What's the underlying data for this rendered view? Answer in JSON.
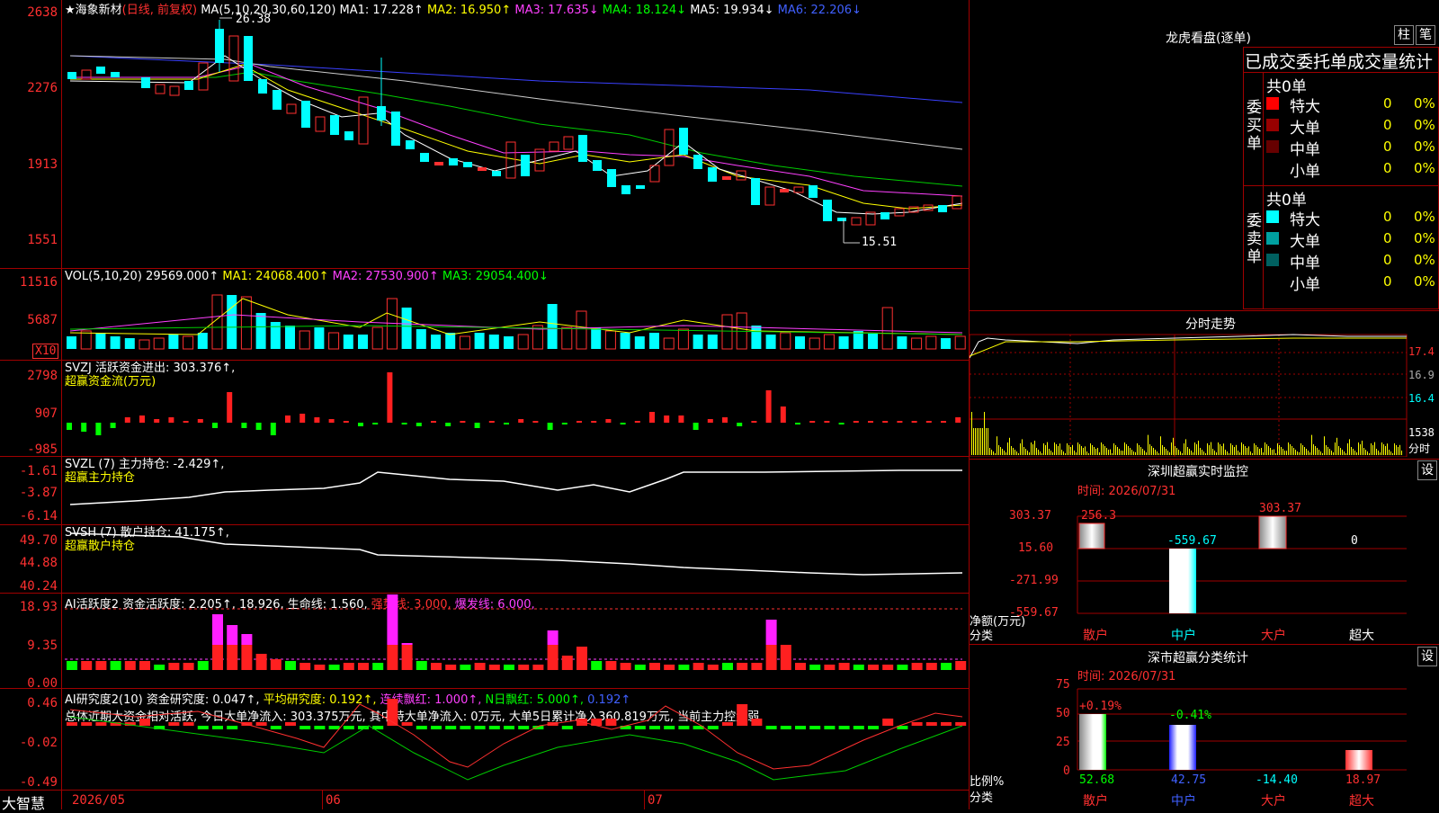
{
  "main": {
    "title": "★海象新材",
    "period": "(日线, 前复权)",
    "ma_label": "MA(5,10,20,30,60,120)",
    "ma1": "MA1: 17.228↑",
    "ma2": "MA2: 16.950↑",
    "ma3": "MA3: 17.635↓",
    "ma4": "MA4: 18.124↓",
    "ma5": "MA5: 19.934↓",
    "ma6": "MA6: 22.206↓",
    "high_mark": "26.38",
    "low_mark": "15.51",
    "y_ticks": [
      "2638",
      "2276",
      "1913",
      "1551"
    ]
  },
  "vol": {
    "label": "VOL(5,10,20)",
    "value": "29569.000↑",
    "ma1": "MA1: 24068.400↑",
    "ma2": "MA2: 27530.900↑",
    "ma3": "MA3: 29054.400↓",
    "y_ticks": [
      "11516",
      "5687"
    ],
    "unit": "X10"
  },
  "svzj": {
    "line1": "SVZJ  活跃资金进出: 303.376↑,",
    "line2": "超赢资金流(万元)",
    "y_ticks": [
      "2798",
      "907",
      "-985"
    ]
  },
  "svzl": {
    "line1": "SVZL (7) 主力持仓: -2.429↑,",
    "line2": "超赢主力持仓",
    "y_ticks": [
      "-1.61",
      "-3.87",
      "-6.14"
    ]
  },
  "svsh": {
    "line1": "SVSH (7) 散户持仓: 41.175↑,",
    "line2": "超赢散户持仓",
    "y_ticks": [
      "49.70",
      "44.88",
      "40.24"
    ]
  },
  "ai1": {
    "label": "AI活跃度2 资金活跃度: 2.205↑, 18.926, 生命线: 1.560,",
    "strong": "强势线: 3.000,",
    "burst": "爆发线: 6.000,",
    "y_ticks": [
      "18.93",
      "9.35",
      "0.00"
    ]
  },
  "ai2": {
    "label": "AI研究度2(10) 资金研究度: 0.047↑,",
    "avg": "平均研究度: 0.192↑,",
    "red1": "连续飘红: 1.000↑,",
    "red2": "N日飘红: 5.000↑,",
    "val": "0.192↑",
    "summary": "总体近期大资金相对活跃, 今日大单净流入: 303.375万元, 其中特大单净流入: 0万元, 大单5日累计净入360.819万元, 当前主力控盘弱",
    "y_ticks": [
      "0.46",
      "-0.02",
      "-0.49"
    ]
  },
  "bottom": {
    "brand": "大智慧",
    "dates": [
      "2026/05",
      "06",
      "07"
    ]
  },
  "right": {
    "dragon_title": "龙虎看盘(逐单)",
    "btn1": "柱",
    "btn2": "笔",
    "stats_title": "已成交委托单成交量统计",
    "buy_label": "委买单",
    "sell_label": "委卖单",
    "buy_total": "共0单",
    "sell_total": "共0单",
    "buy_rows": [
      {
        "name": "特大",
        "count": "0",
        "pct": "0%",
        "color": "#ff0000"
      },
      {
        "name": "大单",
        "count": "0",
        "pct": "0%",
        "color": "#990000"
      },
      {
        "name": "中单",
        "count": "0",
        "pct": "0%",
        "color": "#660000"
      },
      {
        "name": "小单",
        "count": "0",
        "pct": "0%",
        "color": "#000000"
      }
    ],
    "sell_rows": [
      {
        "name": "特大",
        "count": "0",
        "pct": "0%",
        "color": "#00ffff"
      },
      {
        "name": "大单",
        "count": "0",
        "pct": "0%",
        "color": "#00a0a0"
      },
      {
        "name": "中单",
        "count": "0",
        "pct": "0%",
        "color": "#006060"
      },
      {
        "name": "小单",
        "count": "0",
        "pct": "0%",
        "color": "#000000"
      }
    ],
    "intraday_title": "分时走势",
    "intraday_ticks": [
      "17.4",
      "16.9",
      "16.4"
    ],
    "intraday_vol": "1538",
    "intraday_vol_label": "分时",
    "sz_title": "深圳超赢实时监控",
    "sz_btn": "设",
    "sz_time": "时间: 2026/07/31",
    "sz_yticks": [
      "303.37",
      "15.60",
      "-271.99",
      "-559.67"
    ],
    "sz_ylabel1": "净额(万元)",
    "sz_ylabel2": "分类",
    "sz_bars": [
      {
        "cat": "散户",
        "value": "256.3"
      },
      {
        "cat": "中户",
        "value": "-559.67"
      },
      {
        "cat": "大户",
        "value": "303.37"
      },
      {
        "cat": "超大",
        "value": "0"
      }
    ],
    "cls_title": "深市超赢分类统计",
    "cls_btn": "设",
    "cls_time": "时间: 2026/07/31",
    "cls_yticks": [
      "75",
      "50",
      "25",
      "0"
    ],
    "cls_ylabel1": "比例%",
    "cls_ylabel2": "分类",
    "cls_bars": [
      {
        "cat": "散户",
        "pct": "52.68",
        "change": "+0.19%"
      },
      {
        "cat": "中户",
        "pct": "42.75",
        "change": "-0.41%"
      },
      {
        "cat": "大户",
        "pct": "-14.40",
        "change": ""
      },
      {
        "cat": "超大",
        "pct": "18.97",
        "change": ""
      }
    ]
  },
  "colors": {
    "up": "#ff3030",
    "down": "#00ffff",
    "border": "#a00000"
  }
}
